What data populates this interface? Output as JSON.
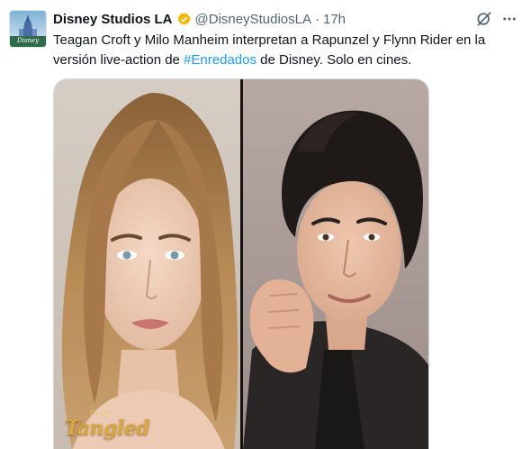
{
  "account": {
    "display_name": "Disney Studios LA",
    "handle": "@DisneyStudiosLA",
    "separator": "·",
    "timestamp": "17h",
    "avatar_text": "Disney",
    "verified_color": "#f4b400"
  },
  "tweet": {
    "text_before": "Teagan Croft y Milo Manheim interpretan a Rapunzel y Flynn Rider en la versión live-action de ",
    "hashtag": "#Enredados",
    "text_after": " de Disney. Solo en cines."
  },
  "media": {
    "logo_super": "Disney",
    "logo_text": "Tangled",
    "left_photo_desc": "woman-portrait",
    "right_photo_desc": "man-portrait"
  },
  "icons": {
    "grok": "grok-icon",
    "more": "more-icon",
    "verified": "verified-badge-icon"
  },
  "colors": {
    "link": "#1d9bf0",
    "secondary": "#536471",
    "text": "#0f1419"
  }
}
